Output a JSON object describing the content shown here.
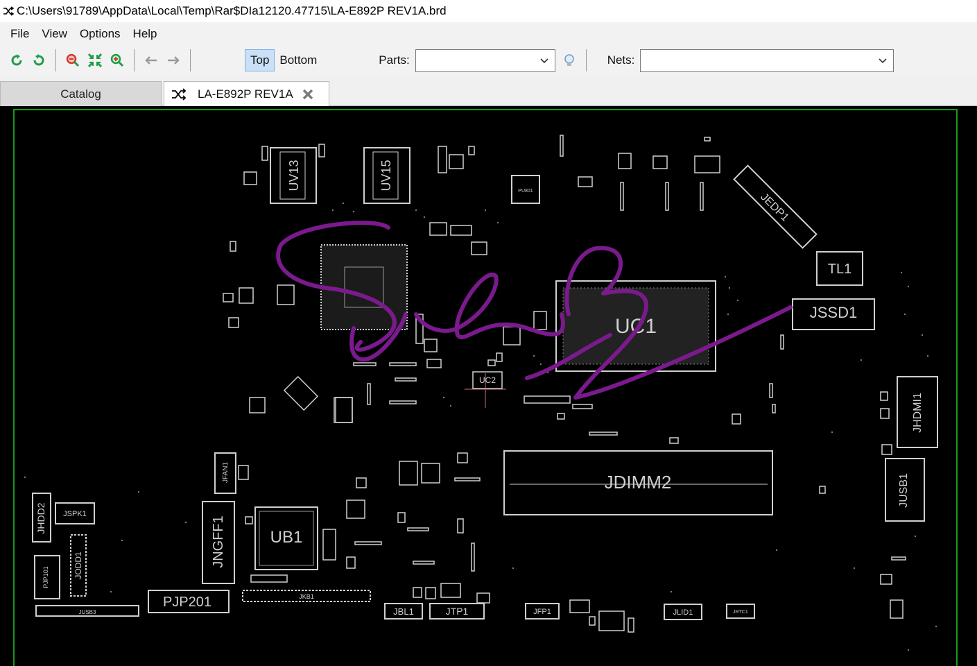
{
  "window": {
    "title": "C:\\Users\\91789\\AppData\\Local\\Temp\\Rar$DIa12120.47715\\LA-E892P REV1A.brd",
    "icon": "shuffle-icon"
  },
  "menu": [
    {
      "label": "File"
    },
    {
      "label": "View"
    },
    {
      "label": "Options"
    },
    {
      "label": "Help"
    }
  ],
  "toolbar": {
    "buttons": [
      {
        "icon": "rotate-left-icon",
        "color": "#1f9d4a"
      },
      {
        "icon": "rotate-right-icon",
        "color": "#1f9d4a"
      },
      {
        "icon": "zoom-out-icon",
        "color": "#d03a2f"
      },
      {
        "icon": "fit-screen-icon",
        "color": "#1f9d4a"
      },
      {
        "icon": "zoom-in-icon",
        "color": "#1f9d4a"
      },
      {
        "icon": "arrow-back-icon",
        "color": "#9b9b9b"
      },
      {
        "icon": "arrow-forward-icon",
        "color": "#9b9b9b"
      }
    ],
    "top_label": "Top",
    "bottom_label": "Bottom",
    "active_layer": "Top",
    "parts_label": "Parts:",
    "parts_value": "",
    "bulb_icon": "lightbulb-icon",
    "nets_label": "Nets:",
    "nets_value": ""
  },
  "tabs": [
    {
      "label": "Catalog",
      "active": false
    },
    {
      "label": "LA-E892P REV1A",
      "active": true,
      "icon": "shuffle-icon",
      "close_icon": "close-icon"
    }
  ],
  "board": {
    "background": "#000000",
    "outline_color": "#1a9a1a",
    "silk_color": "#cfcfcf",
    "annotation_color": "#7a1a8c",
    "components": [
      {
        "ref": "UV13"
      },
      {
        "ref": "UV15"
      },
      {
        "ref": "JEDP1"
      },
      {
        "ref": "TL1"
      },
      {
        "ref": "JSSD1"
      },
      {
        "ref": "UC1"
      },
      {
        "ref": "UC2"
      },
      {
        "ref": "JHDMI1"
      },
      {
        "ref": "JDIMM2"
      },
      {
        "ref": "JUSB1"
      },
      {
        "ref": "JFAN1"
      },
      {
        "ref": "UB1"
      },
      {
        "ref": "JNGFF1"
      },
      {
        "ref": "JHDD2"
      },
      {
        "ref": "JSPK1"
      },
      {
        "ref": "PJP101"
      },
      {
        "ref": "JODD1"
      },
      {
        "ref": "JUSB3"
      },
      {
        "ref": "PJP201"
      },
      {
        "ref": "JKB1"
      },
      {
        "ref": "JBL1"
      },
      {
        "ref": "JTP1"
      },
      {
        "ref": "JFP1"
      },
      {
        "ref": "JLID1"
      },
      {
        "ref": "JRTC1"
      },
      {
        "ref": "PU801"
      }
    ]
  }
}
